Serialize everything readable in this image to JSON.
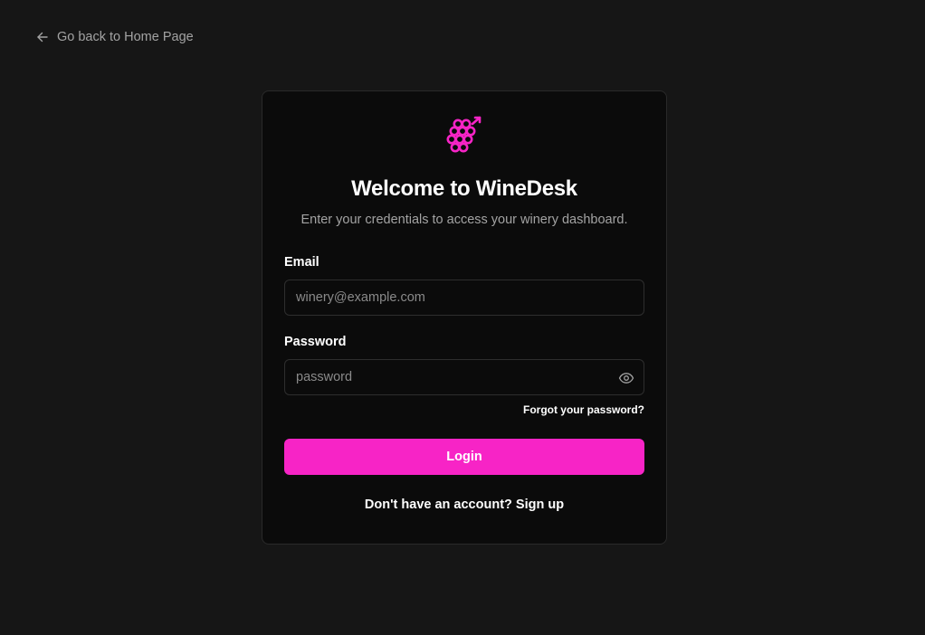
{
  "nav": {
    "back_label": "Go back to Home Page",
    "back_icon": "arrow-left-icon"
  },
  "brand": {
    "logo_icon": "grapes-icon",
    "accent_color": "#f724c6"
  },
  "login": {
    "title": "Welcome to WineDesk",
    "subtitle": "Enter your credentials to access your winery dashboard.",
    "email": {
      "label": "Email",
      "placeholder": "winery@example.com",
      "value": ""
    },
    "password": {
      "label": "Password",
      "placeholder": "password",
      "value": "",
      "toggle_icon": "eye-icon"
    },
    "forgot_label": "Forgot your password?",
    "submit_label": "Login",
    "signup_prompt": "Don't have an account? ",
    "signup_label": "Sign up"
  }
}
